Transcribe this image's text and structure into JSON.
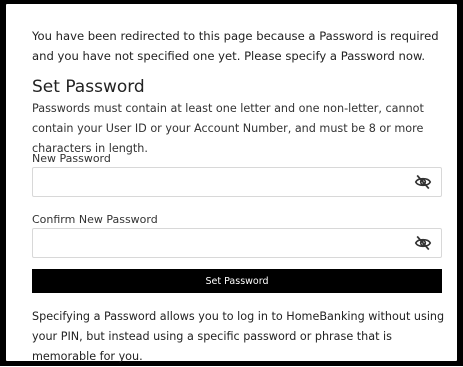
{
  "intro_text": "You have been redirected to this page because a Password is required and you have not specified one yet. Please specify a Password now.",
  "form": {
    "title": "Set Password",
    "rules": "Passwords must contain at least one letter and one non-letter, cannot contain your User ID or your Account Number, and must be 8 or more characters in length.",
    "new_password": {
      "label": "New Password",
      "value": "",
      "toggle_icon": "eye-slash-icon"
    },
    "confirm_password": {
      "label": "Confirm New Password",
      "value": "",
      "toggle_icon": "eye-slash-icon"
    },
    "submit_label": "Set Password",
    "footer_text": "Specifying a Password allows you to log in to HomeBanking without using your PIN, but instead using a specific password or phrase that is memorable for you."
  },
  "colors": {
    "button_bg": "#000000",
    "button_text": "#ffffff",
    "border": "#d8d8d8"
  }
}
